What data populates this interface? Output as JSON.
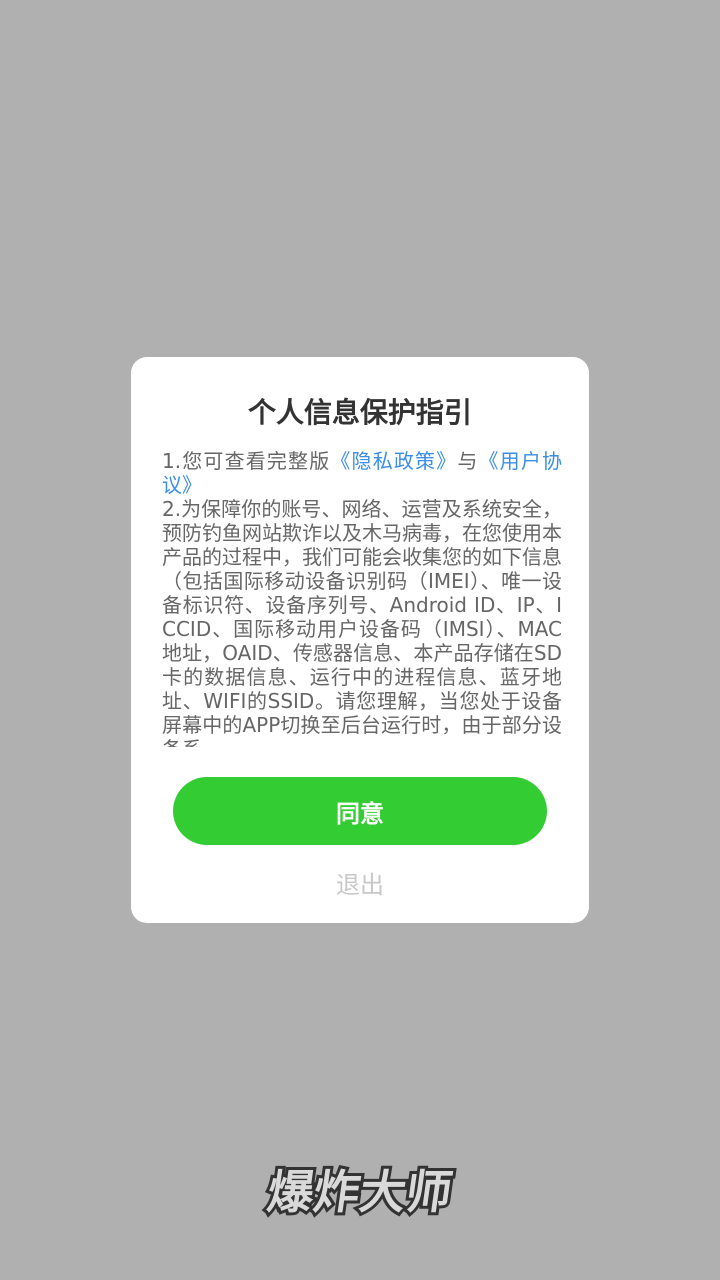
{
  "dialog": {
    "title": "个人信息保护指引",
    "line1_prefix": "1.您可查看完整版",
    "privacy_link": "《隐私政策》",
    "line1_and": "与",
    "user_agreement_link": "《用户协议》",
    "paragraph2": "2.为保障你的账号、网络、运营及系统安全，预防钓鱼网站欺诈以及木马病毒，在您使用本产品的过程中，我们可能会收集您的如下信息（包括国际移动设备识别码（IMEI）、唯一设备标识符、设备序列号、Android ID、IP、ICCID、国际移动用户设备码（IMSI）、MAC地址，OAID、传感器信息、本产品存储在SD卡的数据信息、运行中的进程信息、蓝牙地址、WIFI的SSID。请您理解，当您处于设备屏幕中的APP切换至后台运行时，由于部分设备系",
    "agree_label": "同意",
    "exit_label": "退出"
  },
  "logo": {
    "text": "爆炸大师"
  },
  "colors": {
    "overlay": "#b0b0b0",
    "agree_button": "#33cc33",
    "link": "#3a8ee6",
    "exit_text": "#c8c8c8"
  }
}
